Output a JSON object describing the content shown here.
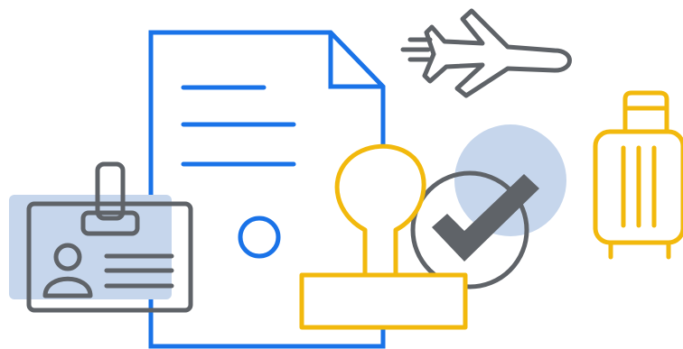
{
  "palette": {
    "blue": "#1a73e8",
    "gray": "#5f6368",
    "yellow": "#f2b90d",
    "highlight": "#c6d6ec",
    "background": "#ffffff"
  },
  "icons": [
    "document-icon",
    "id-badge-icon",
    "approval-stamp-icon",
    "check-mark-icon",
    "airplane-icon",
    "suitcase-icon"
  ]
}
